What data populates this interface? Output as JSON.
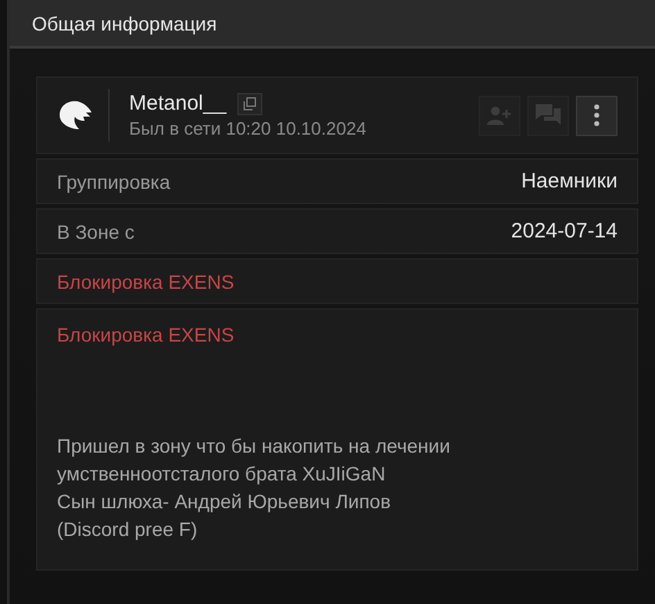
{
  "header": {
    "title": "Общая информация"
  },
  "profile": {
    "name": "Metanol__",
    "last_seen": "Был в сети 10:20 10.10.2024",
    "actions": [
      {
        "kind": "add-friend",
        "disabled": true
      },
      {
        "kind": "message",
        "disabled": true
      },
      {
        "kind": "more",
        "disabled": false
      }
    ]
  },
  "fields": [
    {
      "label": "Группировка",
      "value": "Наемники"
    },
    {
      "label": "В Зоне с",
      "value": "2024-07-14"
    }
  ],
  "ban_label": "Блокировка EXENS",
  "status": {
    "title": "Блокировка EXENS",
    "text": "Пришел в зону что бы накопить на лечении\nумственноотсталого брата XuJIiGaN\nСын шлюха- Андрей Юрьевич Липов\n(Discord pree F)"
  }
}
